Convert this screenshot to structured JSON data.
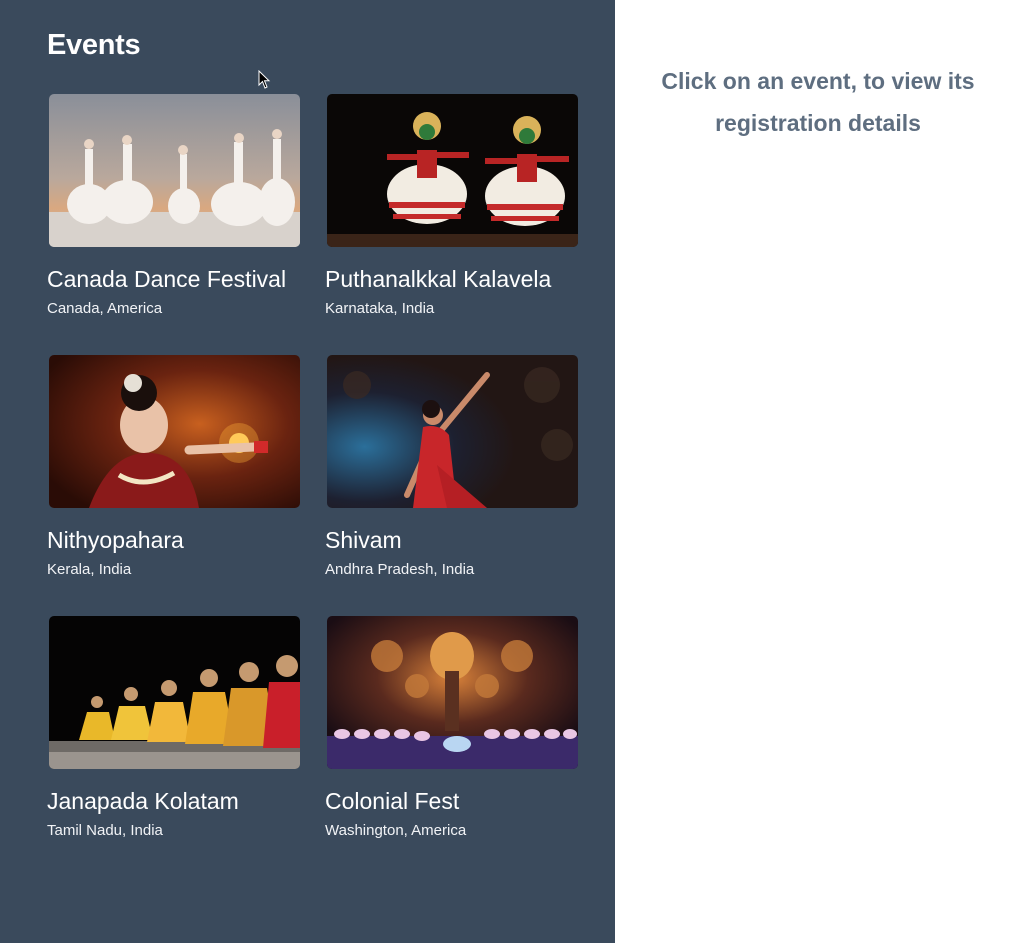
{
  "panel": {
    "title": "Events"
  },
  "events": [
    {
      "title": "Canada Dance Festival",
      "location": "Canada, America",
      "image": "ballet-dancers-photo"
    },
    {
      "title": "Puthanalkkal Kalavela",
      "location": "Karnataka, India",
      "image": "kathakali-dancers-photo"
    },
    {
      "title": "Nithyopahara",
      "location": "Kerala, India",
      "image": "classical-dancer-lamp-photo"
    },
    {
      "title": "Shivam",
      "location": "Andhra Pradesh, India",
      "image": "bharatanatyam-dancer-photo"
    },
    {
      "title": "Janapada Kolatam",
      "location": "Tamil Nadu, India",
      "image": "kolatam-group-photo"
    },
    {
      "title": "Colonial Fest",
      "location": "Washington, America",
      "image": "ballet-stage-photo"
    }
  ],
  "details": {
    "placeholder": "Click on an event, to view its registration details"
  },
  "colors": {
    "panel_bg": "#3a4a5c",
    "hint_text": "#5e6e80"
  }
}
